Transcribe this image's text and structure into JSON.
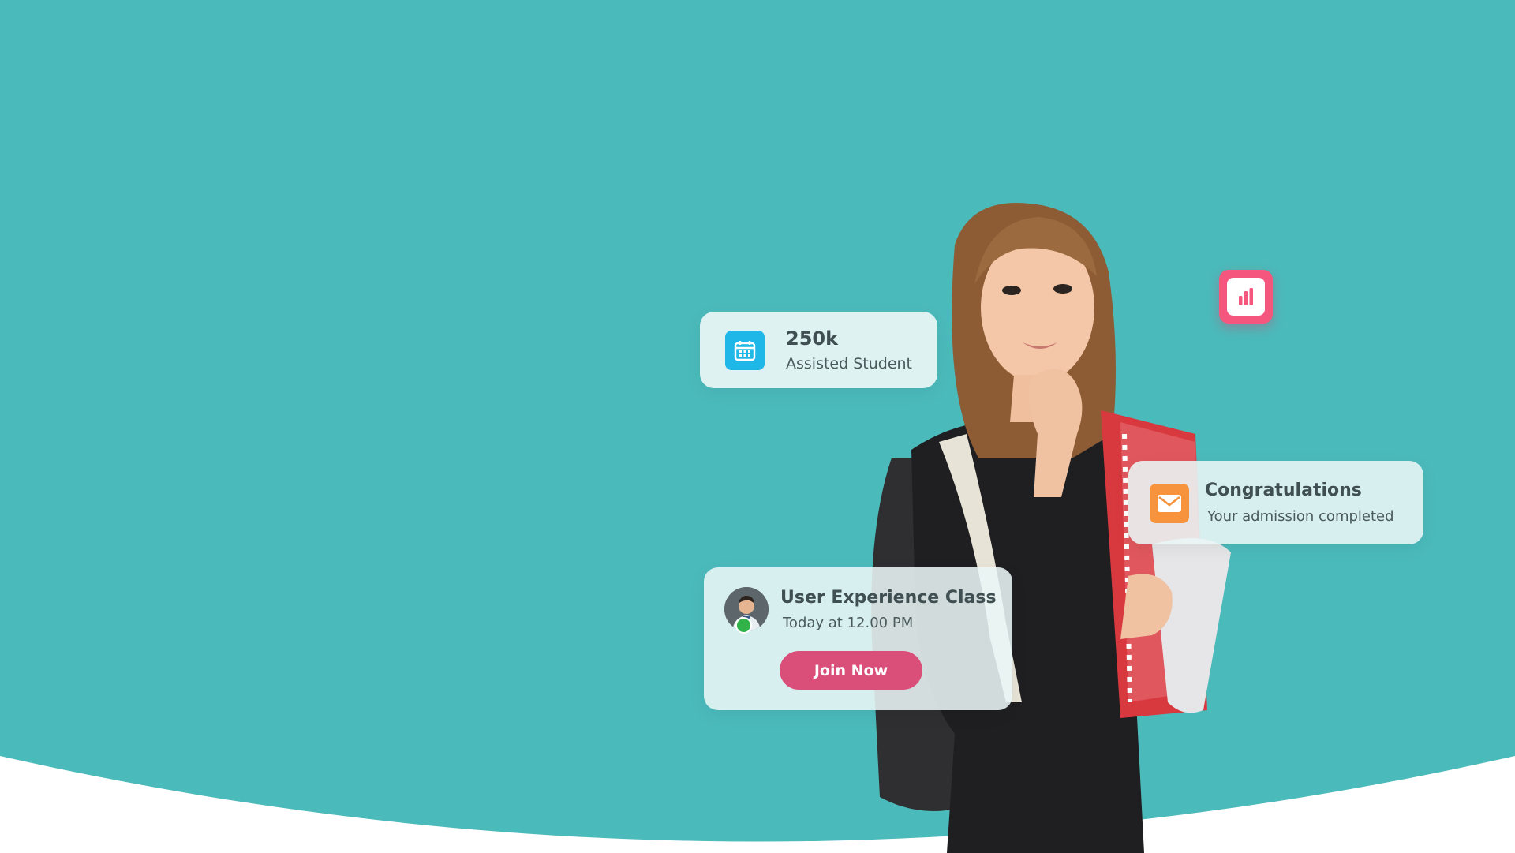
{
  "hero": {
    "background_color": "#4bbabb",
    "stats_card": {
      "icon": "calendar-icon",
      "value": "250k",
      "label": "Assisted Student"
    },
    "congrats_card": {
      "icon": "mail-icon",
      "title": "Congratulations",
      "message": "Your admission completed"
    },
    "class_card": {
      "avatar": "instructor-avatar",
      "title": "User Experience Class",
      "time": "Today at 12.00 PM",
      "button_label": "Join Now"
    },
    "chart_badge": {
      "icon": "bar-chart-icon"
    }
  },
  "colors": {
    "teal": "#4bbabb",
    "pink": "#d94f79",
    "chart_badge_pink": "#f4567d",
    "calendar_blue": "#1fb7e7",
    "mail_orange": "#f6933c",
    "online_green": "#31b34a"
  }
}
